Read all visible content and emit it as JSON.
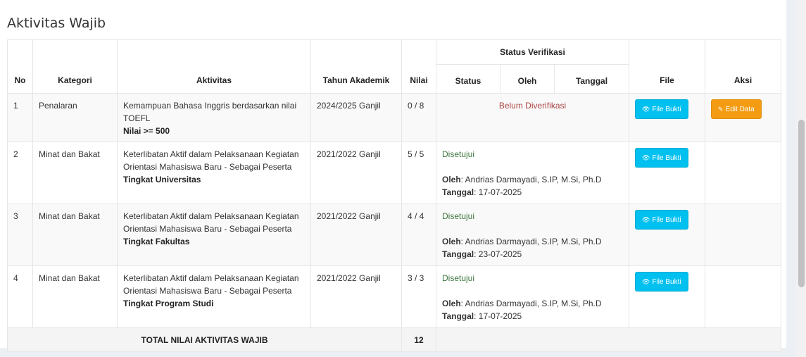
{
  "section": {
    "title": "Aktivitas Wajib"
  },
  "table": {
    "headers": {
      "no": "No",
      "kategori": "Kategori",
      "aktivitas": "Aktivitas",
      "tahun": "Tahun Akademik",
      "nilai": "Nilai",
      "status_verifikasi": "Status Verifikasi",
      "status": "Status",
      "oleh": "Oleh",
      "tanggal": "Tanggal",
      "file": "File",
      "aksi": "Aksi"
    },
    "rows": [
      {
        "no": "1",
        "kategori": "Penalaran",
        "aktivitas": "Kemampuan Bahasa Inggris berdasarkan nilai TOEFL",
        "detail": "Nilai >= 500",
        "tahun": "2024/2025 Ganjil",
        "nilai": "0 / 8",
        "status": "Belum Diverifikasi",
        "file_button": "File Bukti",
        "edit_button": "Edit Data"
      },
      {
        "no": "2",
        "kategori": "Minat dan Bakat",
        "aktivitas": "Keterlibatan Aktif dalam Pelaksanaan Kegiatan Orientasi Mahasiswa Baru - Sebagai Peserta",
        "detail": "Tingkat Universitas",
        "tahun": "2021/2022 Ganjil",
        "nilai": "5 / 5",
        "status": "Disetujui",
        "oleh_label": "Oleh",
        "oleh": ": Andrias Darmayadi, S.IP, M.Si, Ph.D",
        "tanggal_label": "Tanggal",
        "tanggal": ": 17-07-2025",
        "file_button": "File Bukti"
      },
      {
        "no": "3",
        "kategori": "Minat dan Bakat",
        "aktivitas": "Keterlibatan Aktif dalam Pelaksanaan Kegiatan Orientasi Mahasiswa Baru - Sebagai Peserta",
        "detail": "Tingkat Fakultas",
        "tahun": "2021/2022 Ganjil",
        "nilai": "4 / 4",
        "status": "Disetujui",
        "oleh_label": "Oleh",
        "oleh": ": Andrias Darmayadi, S.IP, M.Si, Ph.D",
        "tanggal_label": "Tanggal",
        "tanggal": ": 23-07-2025",
        "file_button": "File Bukti"
      },
      {
        "no": "4",
        "kategori": "Minat dan Bakat",
        "aktivitas": "Keterlibatan Aktif dalam Pelaksanaan Kegiatan Orientasi Mahasiswa Baru - Sebagai Peserta",
        "detail": "Tingkat Program Studi",
        "tahun": "2021/2022 Ganjil",
        "nilai": "3 / 3",
        "status": "Disetujui",
        "oleh_label": "Oleh",
        "oleh": ": Andrias Darmayadi, S.IP, M.Si, Ph.D",
        "tanggal_label": "Tanggal",
        "tanggal": ": 17-07-2025",
        "file_button": "File Bukti"
      }
    ],
    "total": {
      "label": "TOTAL NILAI AKTIVITAS WAJIB",
      "value": "12"
    }
  },
  "icons": {
    "file": "eye-icon",
    "edit": "edit-icon"
  },
  "colors": {
    "info": "#00c0ef",
    "warning": "#f39c12",
    "approved": "#3c763d",
    "unverified": "#a94442"
  }
}
